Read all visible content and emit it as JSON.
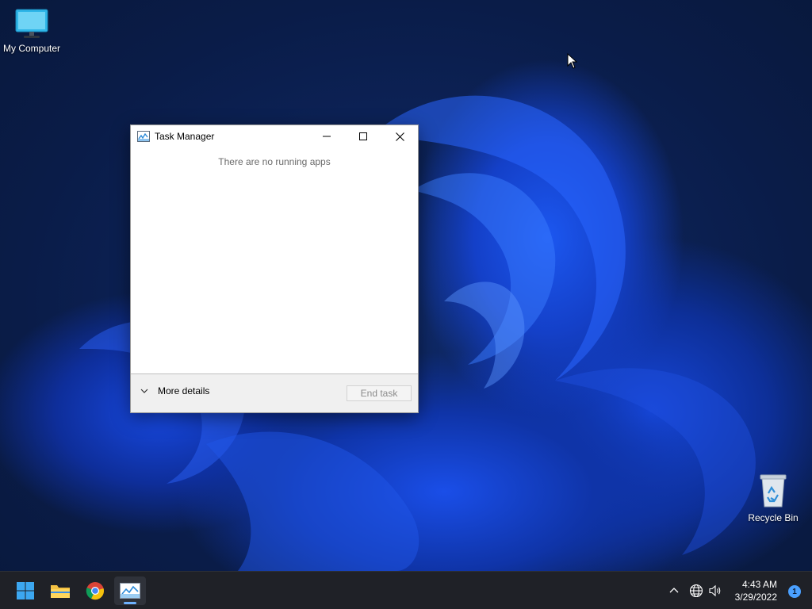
{
  "desktop": {
    "icons": [
      {
        "label": "My Computer",
        "icon": "monitor-icon"
      },
      {
        "label": "Recycle Bin",
        "icon": "recycle-bin-icon"
      }
    ]
  },
  "task_manager": {
    "title": "Task Manager",
    "empty_message": "There are no running apps",
    "more_details_label": "More details",
    "end_task_label": "End task",
    "controls": [
      "minimize-icon",
      "maximize-icon",
      "close-icon"
    ]
  },
  "taskbar": {
    "apps": [
      {
        "name": "Start",
        "icon": "windows-logo-icon"
      },
      {
        "name": "File Explorer",
        "icon": "folder-icon"
      },
      {
        "name": "Google Chrome",
        "icon": "chrome-icon"
      },
      {
        "name": "Task Manager",
        "icon": "task-manager-icon",
        "active": true
      }
    ],
    "tray": {
      "icons": [
        "chevron-up-icon",
        "globe-icon",
        "speaker-icon"
      ],
      "time": "4:43 AM",
      "date": "3/29/2022",
      "notification_count": "1"
    }
  },
  "colors": {
    "accent": "#6fb2ff",
    "taskbar_bg": "#1f2127",
    "wallpaper_blue": "#1c57f0"
  }
}
